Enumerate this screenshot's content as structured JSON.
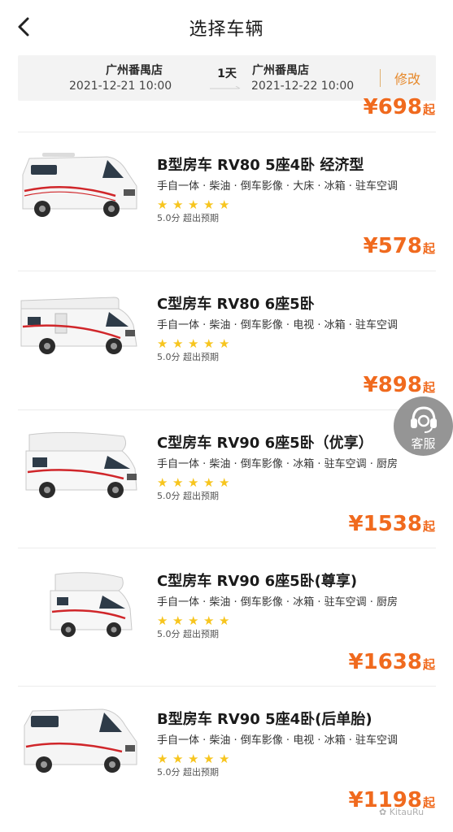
{
  "nav": {
    "title": "选择车辆",
    "back_icon": "chevron-left-icon"
  },
  "route": {
    "pickup_store": "广州番禺店",
    "pickup_time": "2021-12-21 10:00",
    "duration": "1天",
    "return_store": "广州番禺店",
    "return_time": "2021-12-22 10:00",
    "edit_label": "修改"
  },
  "top_price": {
    "amount": "¥698",
    "suffix": "起"
  },
  "vehicles": [
    {
      "name": "B型房车 RV80 5座4卧 经济型",
      "features": "手自一体 · 柴油 · 倒车影像 · 大床 · 冰箱 · 驻车空调",
      "stars": 5,
      "rating": "5.0分 超出预期",
      "price": "¥578",
      "suffix": "起"
    },
    {
      "name": "C型房车 RV80 6座5卧",
      "features": "手自一体 · 柴油 · 倒车影像 · 电视 · 冰箱 · 驻车空调",
      "stars": 5,
      "rating": "5.0分 超出预期",
      "price": "¥898",
      "suffix": "起"
    },
    {
      "name": "C型房车 RV90 6座5卧（优享）",
      "features": "手自一体 · 柴油 · 倒车影像 · 冰箱 · 驻车空调 · 厨房",
      "stars": 5,
      "rating": "5.0分 超出预期",
      "price": "¥1538",
      "suffix": "起"
    },
    {
      "name": "C型房车 RV90 6座5卧(尊享)",
      "features": "手自一体 · 柴油 · 倒车影像 · 冰箱 · 驻车空调 · 厨房",
      "stars": 5,
      "rating": "5.0分 超出预期",
      "price": "¥1638",
      "suffix": "起"
    },
    {
      "name": "B型房车 RV90 5座4卧(后单胎)",
      "features": "手自一体 · 柴油 · 倒车影像 · 电视 · 冰箱 · 驻车空调",
      "stars": 5,
      "rating": "5.0分 超出预期",
      "price": "¥1198",
      "suffix": "起"
    }
  ],
  "customer_service": {
    "label": "客服",
    "icon": "headset-icon"
  },
  "watermark": "KitauRu",
  "colors": {
    "accent": "#f06a1e",
    "edit": "#e6892b",
    "star": "#f7c51e"
  }
}
